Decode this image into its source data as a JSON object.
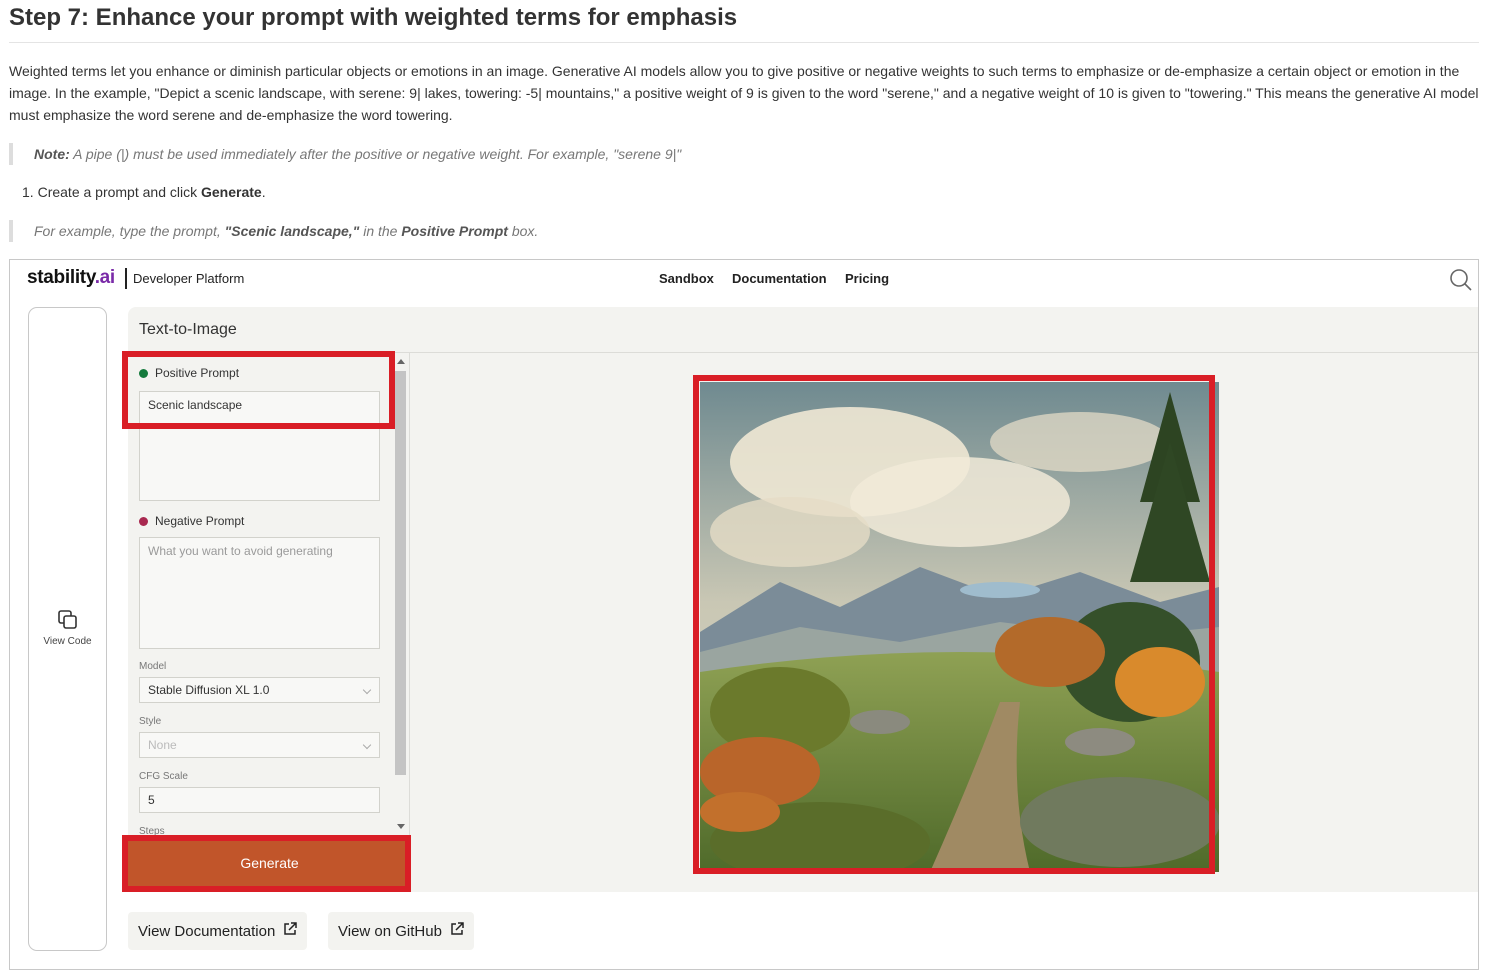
{
  "article": {
    "title": "Step 7: Enhance your prompt with weighted terms for emphasis",
    "intro": "Weighted terms let you enhance or diminish particular objects or emotions in an image. Generative AI models allow you to give positive or negative weights to such terms to emphasize or de-emphasize a certain object or emotion in the image. In the example, \"Depict a scenic landscape, with serene: 9| lakes, towering: -5| mountains,\" a positive weight of 9 is given to the word \"serene,\" and a negative weight of 10 is given to \"towering.\" This means the generative AI model must emphasize the word serene and de-emphasize the word towering.",
    "note_label": "Note:",
    "note_text": " A pipe (|) must be used immediately after the positive or negative weight. For example, \"serene 9|\"",
    "step_number": "1.",
    "step_text_before": "Create a prompt and click ",
    "step_bold": "Generate",
    "step_text_after": ".",
    "example_before": "For example, type the prompt, ",
    "example_prompt": "\"Scenic landscape,\"",
    "example_middle": " in the ",
    "example_box": "Positive Prompt",
    "example_after": " box."
  },
  "app": {
    "logo_text": "stability",
    "logo_accent": ".ai",
    "platform": "Developer Platform",
    "nav": [
      "Sandbox",
      "Documentation",
      "Pricing"
    ],
    "side_view_code": "View Code",
    "workspace_title": "Text-to-Image",
    "positive_label": "Positive Prompt",
    "positive_value": "Scenic landscape",
    "negative_label": "Negative Prompt",
    "negative_placeholder": "What you want to avoid generating",
    "model_label": "Model",
    "model_value": "Stable Diffusion XL 1.0",
    "style_label": "Style",
    "style_value": "None",
    "cfg_label": "CFG Scale",
    "cfg_value": "5",
    "steps_label": "Steps",
    "generate_label": "Generate",
    "view_docs_label": "View Documentation",
    "view_github_label": "View on GitHub"
  },
  "colors": {
    "highlight": "#d91e26",
    "generate_button": "#c1552a",
    "positive_dot": "#147a3c",
    "negative_dot": "#a8284f"
  },
  "icons": [
    "search-icon",
    "copy-icon",
    "external-link-icon",
    "chevron-down-icon"
  ]
}
